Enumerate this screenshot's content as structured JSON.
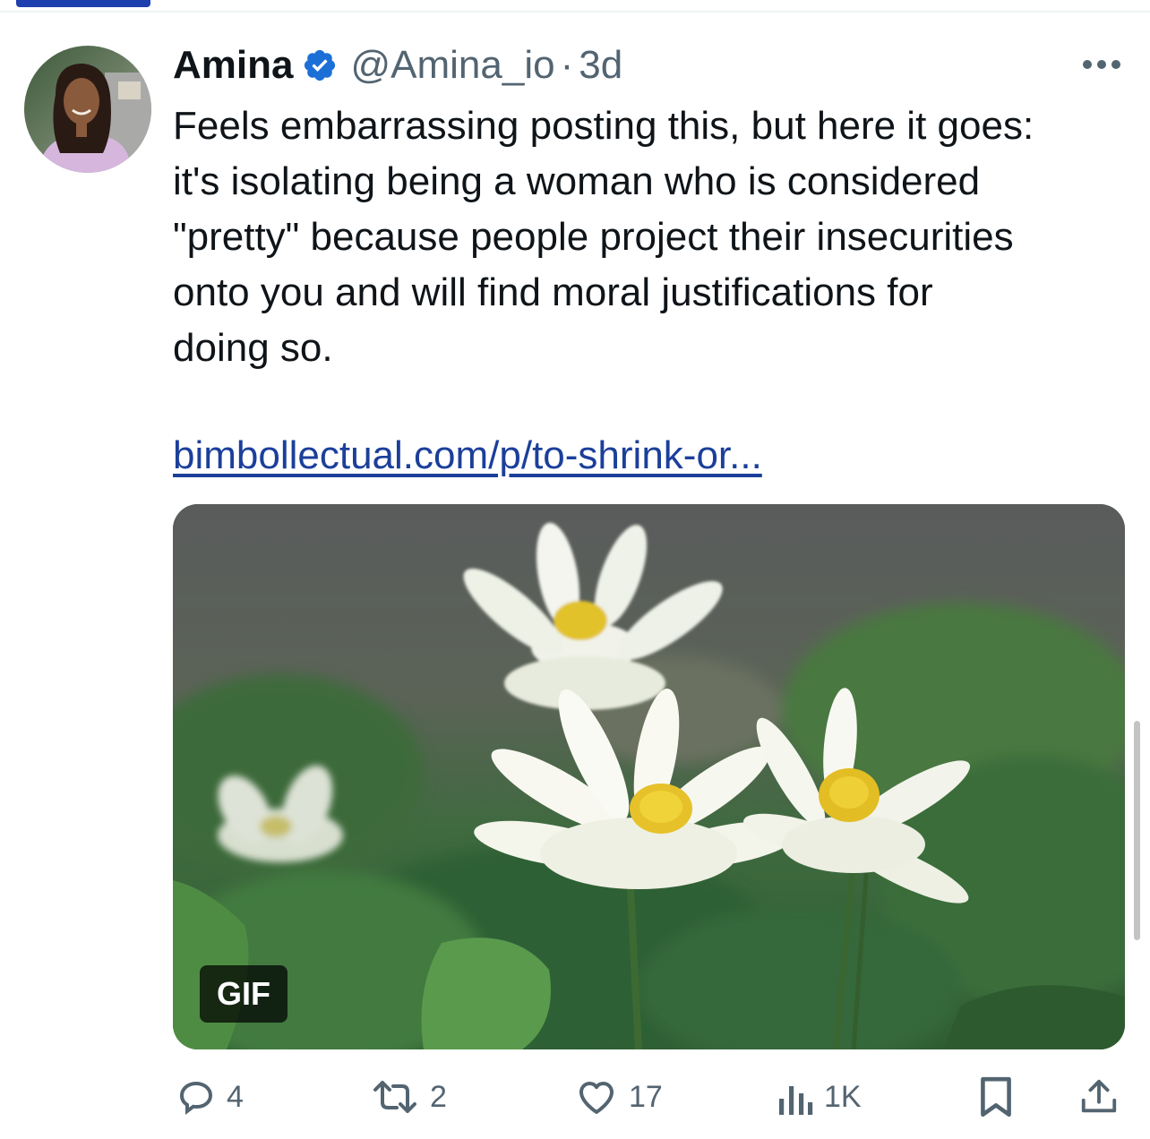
{
  "tweet": {
    "author_name": "Amina",
    "handle": "@Amina_io",
    "separator": "·",
    "time": "3d",
    "text": "Feels embarrassing posting this, but here it goes:\nit's isolating being a woman who is considered\n\"pretty\" because people project their insecurities\nonto you and will find moral justifications for\ndoing so.",
    "link": "bimbollectual.com/p/to-shrink-or...",
    "media_badge": "GIF"
  },
  "actions": {
    "replies": "4",
    "retweets": "2",
    "likes": "17",
    "views": "1K"
  },
  "icons": {
    "verified": "verified-badge-icon",
    "more": "more-dots-icon",
    "reply": "reply-icon",
    "retweet": "retweet-icon",
    "like": "heart-icon",
    "views": "views-icon",
    "bookmark": "bookmark-icon",
    "share": "share-icon"
  },
  "colors": {
    "verified": "#1d9bf0",
    "link": "#1b3f9a",
    "secondary_text": "#536471"
  }
}
